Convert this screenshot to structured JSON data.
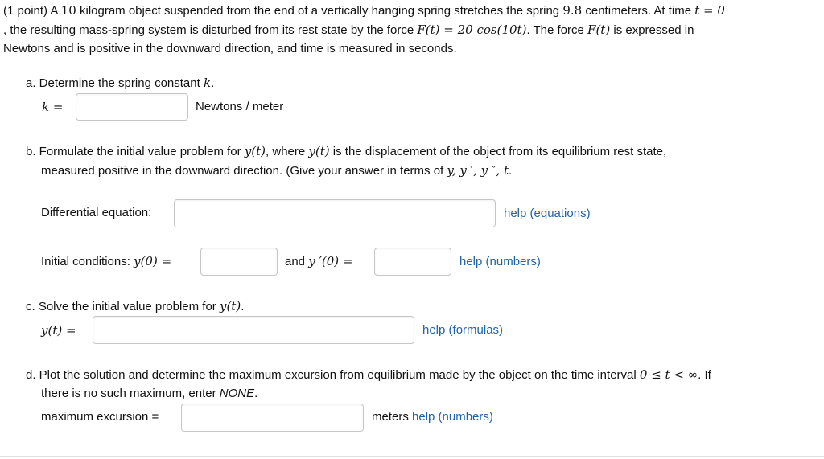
{
  "intro": {
    "line1_a": "(1 point) A",
    "mass": "10",
    "line1_b": "kilogram object suspended from the end of a vertically hanging spring stretches the spring",
    "stretch": "9.8",
    "line1_c": "centimeters. At time",
    "t_eq": "t = 0",
    "line2_a": ", the resulting mass-spring system is disturbed from its rest state by the force",
    "force_expr": "F(t) = 20 cos(10t)",
    "line2_b": ". The force",
    "force_name": "F(t)",
    "line2_c": "is expressed in",
    "line3": "Newtons and is positive in the downward direction, and time is measured in seconds."
  },
  "part_a": {
    "prompt": "a. Determine the spring constant",
    "var": "k",
    "period": ".",
    "label": "k =",
    "value": "",
    "units": "Newtons / meter"
  },
  "part_b": {
    "line1_a": "b. Formulate the initial value problem for",
    "yt1": "y(t)",
    "line1_b": ", where",
    "yt2": "y(t)",
    "line1_c": "is the displacement of the object from its equilibrium rest state,",
    "line2_a": "measured positive in the downward direction. (Give your answer in terms of",
    "terms": "y, y ′, y ″, t",
    "line2_b": ".",
    "diffeq_label": "Differential equation:",
    "diffeq_value": "",
    "help_equations": "help (equations)",
    "ic_label": "Initial conditions:",
    "ic_y0": "y(0) =",
    "ic_y0_value": "",
    "and_text": "and",
    "ic_yp0": "y ′(0) =",
    "ic_yp0_value": "",
    "help_numbers": "help (numbers)"
  },
  "part_c": {
    "prompt": "c. Solve the initial value problem for",
    "yt": "y(t)",
    "period": ".",
    "label": "y(t) =",
    "value": "",
    "help_formulas": "help (formulas)"
  },
  "part_d": {
    "line1_a": "d. Plot the solution and determine the maximum excursion from equilibrium made by the object on the time interval",
    "interval": "0 ≤ t < ∞",
    "line1_b": ". If",
    "line2_a": "there is no such maximum, enter",
    "none_word": "NONE",
    "line2_b": ".",
    "label": "maximum excursion =",
    "value": "",
    "units": "meters",
    "help_numbers": "help (numbers)"
  }
}
